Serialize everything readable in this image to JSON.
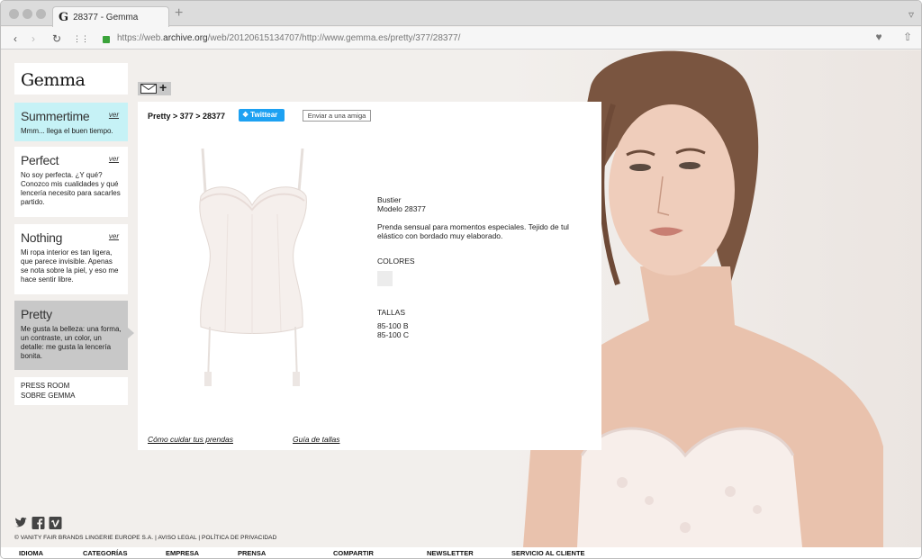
{
  "browser": {
    "tab_title": "28377 - Gemma",
    "tab_favicon": "G",
    "url_prefix": "https://web.",
    "url_domain": "archive.org",
    "url_rest": "/web/20120615134707/http://www.gemma.es/pretty/377/28377/"
  },
  "sidebar": {
    "logo": "Gemma",
    "cards": [
      {
        "title": "Summertime",
        "ver": "ver",
        "desc": "Mmm... llega el buen tiempo."
      },
      {
        "title": "Perfect",
        "ver": "ver",
        "desc": "No soy perfecta. ¿Y qué? Conozco mis cualidades y qué lencería necesito para sacarles partido."
      },
      {
        "title": "Nothing",
        "ver": "ver",
        "desc": "Mi ropa interior es tan ligera, que parece invisible. Apenas se nota sobre la piel, y eso me hace sentir libre."
      },
      {
        "title": "Pretty",
        "desc": "Me gusta la belleza: una forma, un contraste, un color, un detalle: me gusta la lencería bonita."
      }
    ],
    "links": [
      "PRESS ROOM",
      "SOBRE GEMMA"
    ]
  },
  "panel": {
    "breadcrumb": "Pretty  >  377  > 28377",
    "twitter": "Twittear",
    "send_friend": "Enviar a una amiga",
    "product_type": "Bustier",
    "model": "Modelo 28377",
    "description": "Prenda sensual para momentos especiales. Tejido de tul elástico con bordado muy elaborado.",
    "colors_heading": "COLORES",
    "swatch_color": "#ececec",
    "sizes_heading": "TALLAS",
    "sizes": [
      "85-100 B",
      "85-100 C"
    ],
    "care_link": "Cómo cuidar tus prendas",
    "size_guide_link": "Guía de tallas"
  },
  "footer": {
    "social_icons": [
      "twitter-icon",
      "facebook-icon",
      "vimeo-icon"
    ],
    "copyright": "© VANITY FAIR BRANDS LINGERIE EUROPE S.A. | AVISO LEGAL | POLÍTICA DE PRIVACIDAD",
    "nav": [
      "IDIOMA",
      "CATEGORÍAS",
      "EMPRESA",
      "PRENSA",
      "COMPARTIR",
      "NEWSLETTER",
      "SERVICIO AL CLIENTE"
    ]
  },
  "colors": {
    "summertime_bg": "#c6f2f6",
    "pretty_bg": "#c8c8c8",
    "twitter_blue": "#1da1f2",
    "page_bg": "#f2efec"
  }
}
